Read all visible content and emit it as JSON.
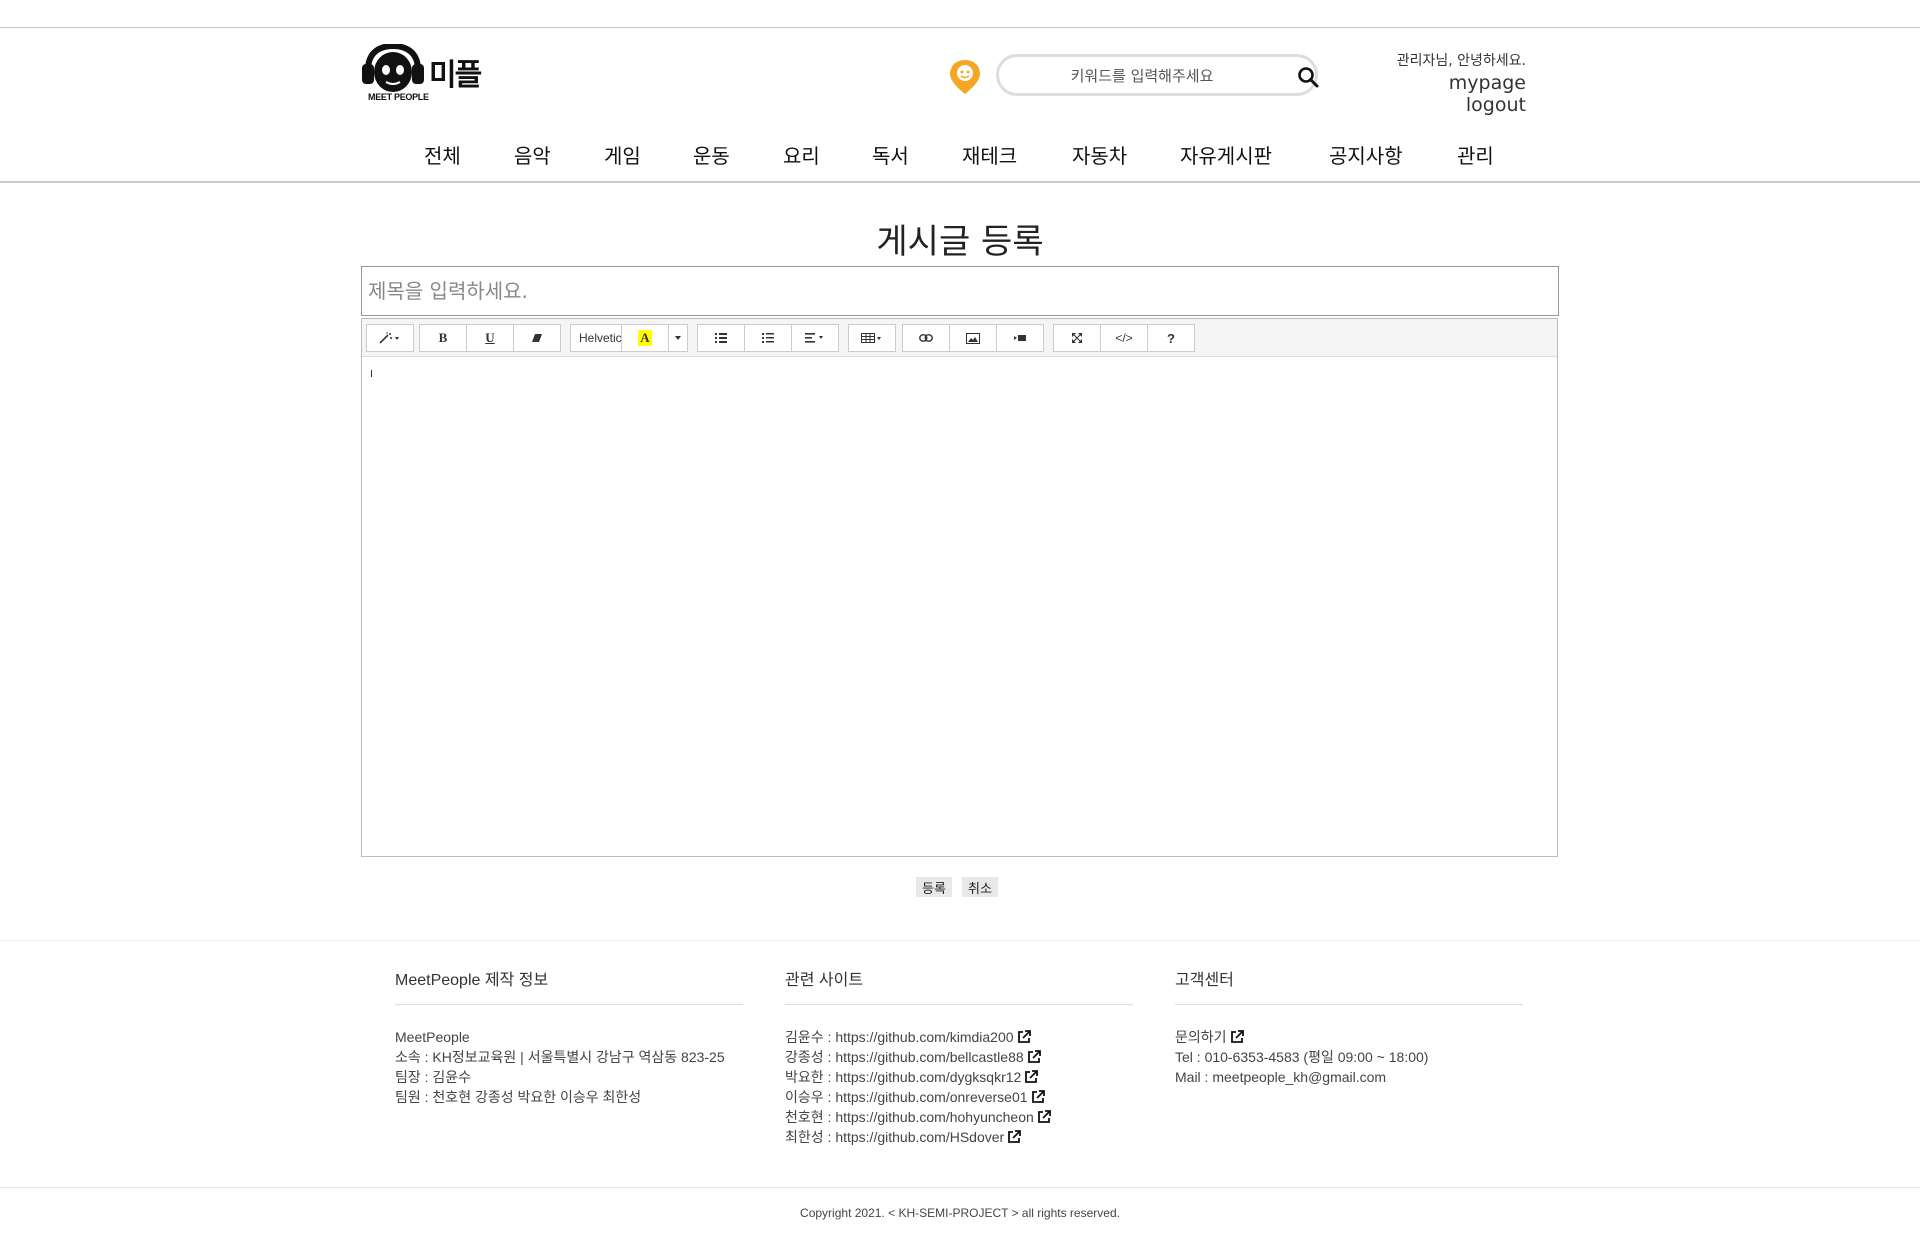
{
  "header": {
    "logo_text": "미플",
    "logo_subtext": "MEET PEOPLE",
    "search": {
      "placeholder": "키워드를 입력해주세요"
    },
    "greeting": "관리자님, 안녕하세요.",
    "links": {
      "mypage": "mypage",
      "logout": "logout"
    },
    "accent_color": "#f5a623"
  },
  "nav": {
    "items": [
      "전체",
      "음악",
      "게임",
      "운동",
      "요리",
      "독서",
      "재테크",
      "자동차",
      "자유게시판",
      "공지사항",
      "관리"
    ]
  },
  "main": {
    "title": "게시글 등록",
    "title_input_placeholder": "제목을 입력하세요.",
    "toolbar": {
      "style_icon": "magic-wand-icon",
      "bold": "B",
      "underline": "U",
      "eraser_icon": "eraser-icon",
      "font_name": "Helvetica",
      "color_label": "A",
      "ul_icon": "unordered-list-icon",
      "ol_icon": "ordered-list-icon",
      "align_icon": "align-icon",
      "table_icon": "table-icon",
      "link_icon": "link-icon",
      "picture_icon": "picture-icon",
      "video_icon": "video-icon",
      "fullscreen_icon": "fullscreen-icon",
      "code_label": "</>",
      "help_label": "?"
    },
    "submit_label": "등록",
    "cancel_label": "취소"
  },
  "footer": {
    "col1": {
      "heading": "MeetPeople 제작 정보",
      "lines": [
        "MeetPeople",
        "소속 : KH정보교육원 | 서울특별시 강남구 역삼동 823-25",
        "팀장 : 김윤수",
        "팀원 : 천호현 강종성 박요한 이승우 최한성"
      ]
    },
    "col2": {
      "heading": "관련 사이트",
      "links": [
        {
          "name": "김윤수",
          "url": "https://github.com/kimdia200"
        },
        {
          "name": "강종성",
          "url": "https://github.com/bellcastle88"
        },
        {
          "name": "박요한",
          "url": "https://github.com/dygksqkr12"
        },
        {
          "name": "이승우",
          "url": "https://github.com/onreverse01"
        },
        {
          "name": "천호현",
          "url": "https://github.com/hohyuncheon"
        },
        {
          "name": "최한성",
          "url": "https://github.com/HSdover"
        }
      ]
    },
    "col3": {
      "heading": "고객센터",
      "contact_link": "문의하기",
      "tel": "Tel : 010-6353-4583 (평일 09:00 ~ 18:00)",
      "mail": "Mail : meetpeople_kh@gmail.com"
    },
    "copyright": "Copyright 2021. < KH-SEMI-PROJECT > all rights reserved."
  }
}
